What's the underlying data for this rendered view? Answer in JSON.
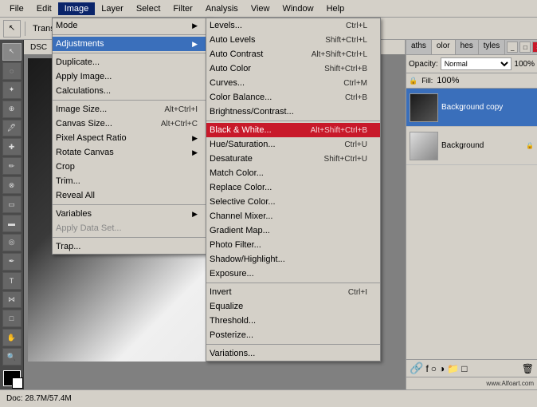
{
  "menubar": {
    "items": [
      "File",
      "Edit",
      "Image",
      "Layer",
      "Select",
      "Filter",
      "Analysis",
      "View",
      "Window",
      "Help"
    ],
    "active": "Image"
  },
  "imageMenu": {
    "items": [
      {
        "label": "Mode",
        "shortcut": "",
        "arrow": "▶",
        "separator": false,
        "disabled": false
      },
      {
        "label": "",
        "separator": true
      },
      {
        "label": "Adjustments",
        "shortcut": "",
        "arrow": "▶",
        "separator": false,
        "disabled": false,
        "highlighted": true
      },
      {
        "label": "",
        "separator": true
      },
      {
        "label": "Duplicate...",
        "shortcut": "",
        "arrow": "",
        "separator": false,
        "disabled": false
      },
      {
        "label": "Apply Image...",
        "shortcut": "",
        "arrow": "",
        "separator": false,
        "disabled": false
      },
      {
        "label": "Calculations...",
        "shortcut": "",
        "arrow": "",
        "separator": false,
        "disabled": false
      },
      {
        "label": "",
        "separator": true
      },
      {
        "label": "Image Size...",
        "shortcut": "Alt+Ctrl+I",
        "arrow": "",
        "separator": false,
        "disabled": false
      },
      {
        "label": "Canvas Size...",
        "shortcut": "Alt+Ctrl+C",
        "arrow": "",
        "separator": false,
        "disabled": false
      },
      {
        "label": "Pixel Aspect Ratio",
        "shortcut": "",
        "arrow": "▶",
        "separator": false,
        "disabled": false
      },
      {
        "label": "Rotate Canvas",
        "shortcut": "",
        "arrow": "▶",
        "separator": false,
        "disabled": false
      },
      {
        "label": "Crop",
        "shortcut": "",
        "arrow": "",
        "separator": false,
        "disabled": false
      },
      {
        "label": "Trim...",
        "shortcut": "",
        "arrow": "",
        "separator": false,
        "disabled": false
      },
      {
        "label": "Reveal All",
        "shortcut": "",
        "arrow": "",
        "separator": false,
        "disabled": false
      },
      {
        "label": "",
        "separator": true
      },
      {
        "label": "Variables",
        "shortcut": "",
        "arrow": "▶",
        "separator": false,
        "disabled": false
      },
      {
        "label": "Apply Data Set...",
        "shortcut": "",
        "arrow": "",
        "separator": false,
        "disabled": true
      },
      {
        "label": "",
        "separator": true
      },
      {
        "label": "Trap...",
        "shortcut": "",
        "arrow": "",
        "separator": false,
        "disabled": false
      }
    ]
  },
  "adjustmentsMenu": {
    "items": [
      {
        "label": "Levels...",
        "shortcut": "Ctrl+L",
        "black_white": false
      },
      {
        "label": "Auto Levels",
        "shortcut": "Shift+Ctrl+L",
        "black_white": false
      },
      {
        "label": "Auto Contrast",
        "shortcut": "Alt+Shift+Ctrl+L",
        "black_white": false
      },
      {
        "label": "Auto Color",
        "shortcut": "Shift+Ctrl+B",
        "black_white": false
      },
      {
        "label": "Curves...",
        "shortcut": "Ctrl+M",
        "black_white": false
      },
      {
        "label": "Color Balance...",
        "shortcut": "Ctrl+B",
        "black_white": false
      },
      {
        "label": "Brightness/Contrast...",
        "shortcut": "",
        "black_white": false
      },
      {
        "label": "sep1",
        "separator": true
      },
      {
        "label": "Black & White...",
        "shortcut": "Alt+Shift+Ctrl+B",
        "black_white": true
      },
      {
        "label": "Hue/Saturation...",
        "shortcut": "Ctrl+U",
        "black_white": false
      },
      {
        "label": "Desaturate",
        "shortcut": "Shift+Ctrl+U",
        "black_white": false
      },
      {
        "label": "Match Color...",
        "shortcut": "",
        "black_white": false
      },
      {
        "label": "Replace Color...",
        "shortcut": "",
        "black_white": false
      },
      {
        "label": "Selective Color...",
        "shortcut": "",
        "black_white": false
      },
      {
        "label": "Channel Mixer...",
        "shortcut": "",
        "black_white": false
      },
      {
        "label": "Gradient Map...",
        "shortcut": "",
        "black_white": false
      },
      {
        "label": "Photo Filter...",
        "shortcut": "",
        "black_white": false
      },
      {
        "label": "Shadow/Highlight...",
        "shortcut": "",
        "black_white": false
      },
      {
        "label": "Exposure...",
        "shortcut": "",
        "black_white": false
      },
      {
        "label": "sep2",
        "separator": true
      },
      {
        "label": "Invert",
        "shortcut": "Ctrl+I",
        "black_white": false
      },
      {
        "label": "Equalize",
        "shortcut": "",
        "black_white": false
      },
      {
        "label": "Threshold...",
        "shortcut": "",
        "black_white": false
      },
      {
        "label": "Posterize...",
        "shortcut": "",
        "black_white": false
      },
      {
        "label": "sep3",
        "separator": true
      },
      {
        "label": "Variations...",
        "shortcut": "",
        "black_white": false
      }
    ]
  },
  "layers": {
    "opacity_label": "Opacity:",
    "opacity_value": "100%",
    "fill_label": "Fill:",
    "fill_value": "100%",
    "items": [
      {
        "name": "Background copy",
        "selected": true,
        "locked": false
      },
      {
        "name": "Background",
        "selected": false,
        "locked": true
      }
    ]
  },
  "status": {
    "doc_info": "Doc: 28.7M/57.4M",
    "website": "www.Alfoart.com"
  },
  "canvas": {
    "tab": "DSC"
  },
  "panelTabs": {
    "tabs": [
      "aths",
      "olor",
      "hes",
      "tyles"
    ]
  }
}
